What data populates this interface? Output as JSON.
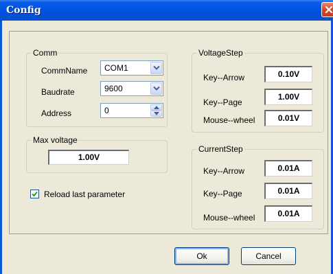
{
  "window": {
    "title": "Config"
  },
  "comm": {
    "legend": "Comm",
    "commname_label": "CommName",
    "commname_value": "COM1",
    "baudrate_label": "Baudrate",
    "baudrate_value": "9600",
    "address_label": "Address",
    "address_value": "0"
  },
  "max_voltage": {
    "legend": "Max voltage",
    "value": "1.00V"
  },
  "reload": {
    "label": "Reload last parameter",
    "checked": true
  },
  "voltage_step": {
    "legend": "VoltageStep",
    "key_arrow_label": "Key--Arrow",
    "key_arrow_value": "0.10V",
    "key_page_label": "Key--Page",
    "key_page_value": "1.00V",
    "mouse_wheel_label": "Mouse--wheel",
    "mouse_wheel_value": "0.01V"
  },
  "current_step": {
    "legend": "CurrentStep",
    "key_arrow_label": "Key--Arrow",
    "key_arrow_value": "0.01A",
    "key_page_label": "Key--Page",
    "key_page_value": "0.01A",
    "mouse_wheel_label": "Mouse--wheel",
    "mouse_wheel_value": "0.01A"
  },
  "buttons": {
    "ok": "Ok",
    "cancel": "Cancel"
  },
  "icons": {
    "close": "close-icon",
    "dropdown": "chevron-down-icon",
    "spin_up": "arrow-up-icon",
    "spin_down": "arrow-down-icon",
    "check": "checkmark-icon"
  },
  "colors": {
    "titlebar": "#0054e3",
    "close": "#d8492a",
    "dialog_bg": "#ece9d8"
  }
}
